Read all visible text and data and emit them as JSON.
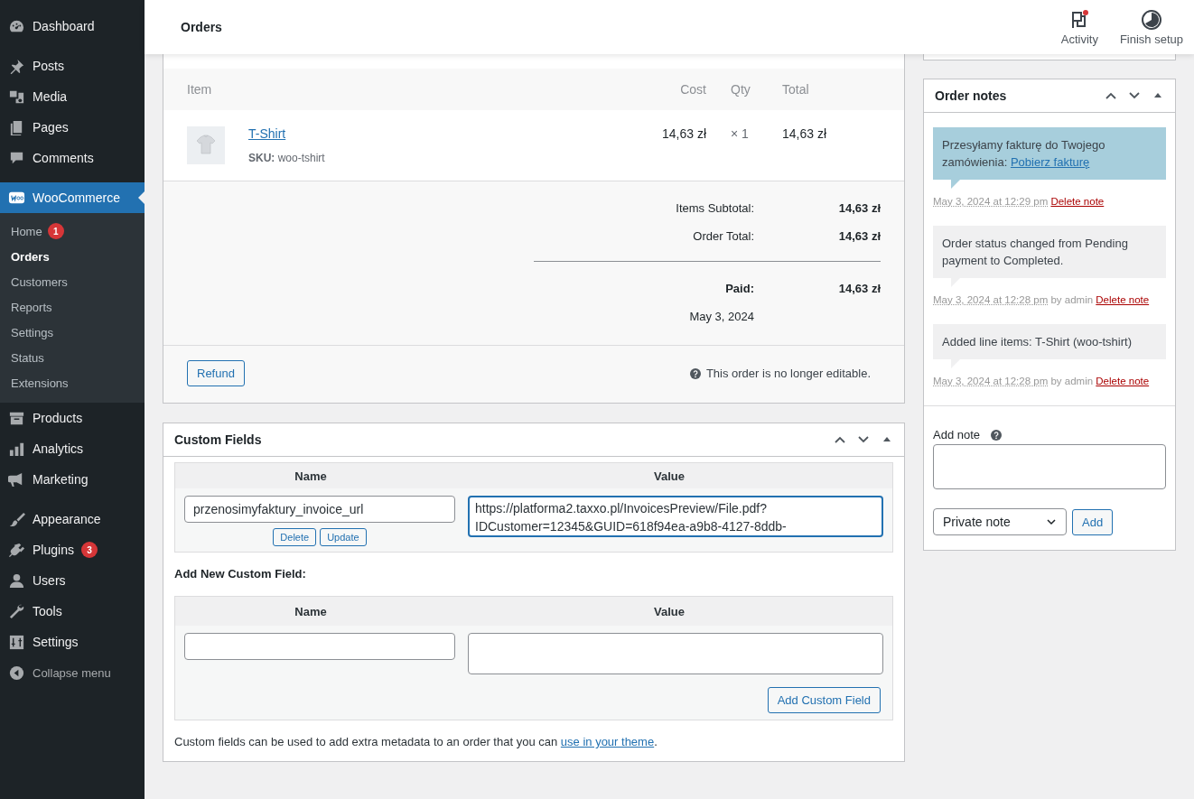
{
  "sidebar": {
    "groups": [
      [
        {
          "label": "Dashboard",
          "selected": false
        }
      ],
      [
        {
          "label": "Posts",
          "selected": false
        },
        {
          "label": "Media",
          "selected": false
        },
        {
          "label": "Pages",
          "selected": false
        },
        {
          "label": "Comments",
          "selected": false
        }
      ],
      [
        {
          "label": "WooCommerce",
          "selected": true,
          "expanded": true,
          "children": [
            {
              "label": "Home",
              "selected": false,
              "badge": "1"
            },
            {
              "label": "Orders",
              "selected": true
            },
            {
              "label": "Customers",
              "selected": false
            },
            {
              "label": "Reports",
              "selected": false
            },
            {
              "label": "Settings",
              "selected": false
            },
            {
              "label": "Status",
              "selected": false
            },
            {
              "label": "Extensions",
              "selected": false
            }
          ]
        },
        {
          "label": "Products",
          "selected": false
        },
        {
          "label": "Analytics",
          "selected": false
        },
        {
          "label": "Marketing",
          "selected": false
        }
      ],
      [
        {
          "label": "Appearance",
          "selected": false
        },
        {
          "label": "Plugins",
          "selected": false,
          "badge": "3"
        },
        {
          "label": "Users",
          "selected": false
        },
        {
          "label": "Tools",
          "selected": false
        },
        {
          "label": "Settings",
          "selected": false
        },
        {
          "label": "Collapse menu",
          "selected": false,
          "kind": "collapse"
        }
      ]
    ]
  },
  "header": {
    "title": "Orders",
    "actions": [
      {
        "label": "Activity",
        "kind": "activity",
        "unread": true
      },
      {
        "label": "Finish setup",
        "kind": "progress"
      }
    ]
  },
  "order_items": {
    "columns": [
      "Item",
      "Cost",
      "Qty",
      "Total"
    ],
    "rows": [
      {
        "name": "T-Shirt",
        "sku_label": "SKU:",
        "sku": "woo-tshirt",
        "cost": "14,63 zł",
        "qty": "× 1",
        "total": "14,63 zł"
      }
    ],
    "totals": [
      {
        "label": "Items Subtotal:",
        "value": "14,63 zł"
      },
      {
        "label": "Order Total:",
        "value": "14,63 zł"
      }
    ],
    "paid": {
      "label": "Paid:",
      "value": "14,63 zł",
      "date": "May 3, 2024"
    },
    "refund_button": "Refund",
    "notice": "This order is no longer editable."
  },
  "custom_fields": {
    "title": "Custom Fields",
    "columns": [
      "Name",
      "Value"
    ],
    "rows": [
      {
        "name": "przenosimyfaktury_invoice_url",
        "value": "https://platforma2.taxxo.pl/InvoicesPreview/File.pdf?IDCustomer=12345&GUID=618f94ea-a9b8-4127-8ddb-",
        "buttons": [
          "Delete",
          "Update"
        ]
      }
    ],
    "add_heading": "Add New Custom Field:",
    "add_columns": [
      "Name",
      "Value"
    ],
    "add_button": "Add Custom Field",
    "footer": "Custom fields can be used to add extra metadata to an order that you can",
    "footer_link": "use in your theme",
    "footer_end": "."
  },
  "order_notes": {
    "title": "Order notes",
    "notes": [
      {
        "kind": "customer",
        "text": "Przesyłamy fakturę do Twojego zamówienia:",
        "link": "Pobierz fakturę",
        "date": "May 3, 2024 at 12:29 pm",
        "delete": "Delete note"
      },
      {
        "kind": "private",
        "text": "Order status changed from Pending payment to Completed.",
        "date": "May 3, 2024 at 12:28 pm",
        "author": "by admin",
        "delete": "Delete note"
      },
      {
        "kind": "private",
        "text": "Added line items: T-Shirt (woo-tshirt)",
        "date": "May 3, 2024 at 12:28 pm",
        "author": "by admin",
        "delete": "Delete note"
      }
    ],
    "add_label": "Add note",
    "note_type": "Private note",
    "add_button": "Add"
  }
}
